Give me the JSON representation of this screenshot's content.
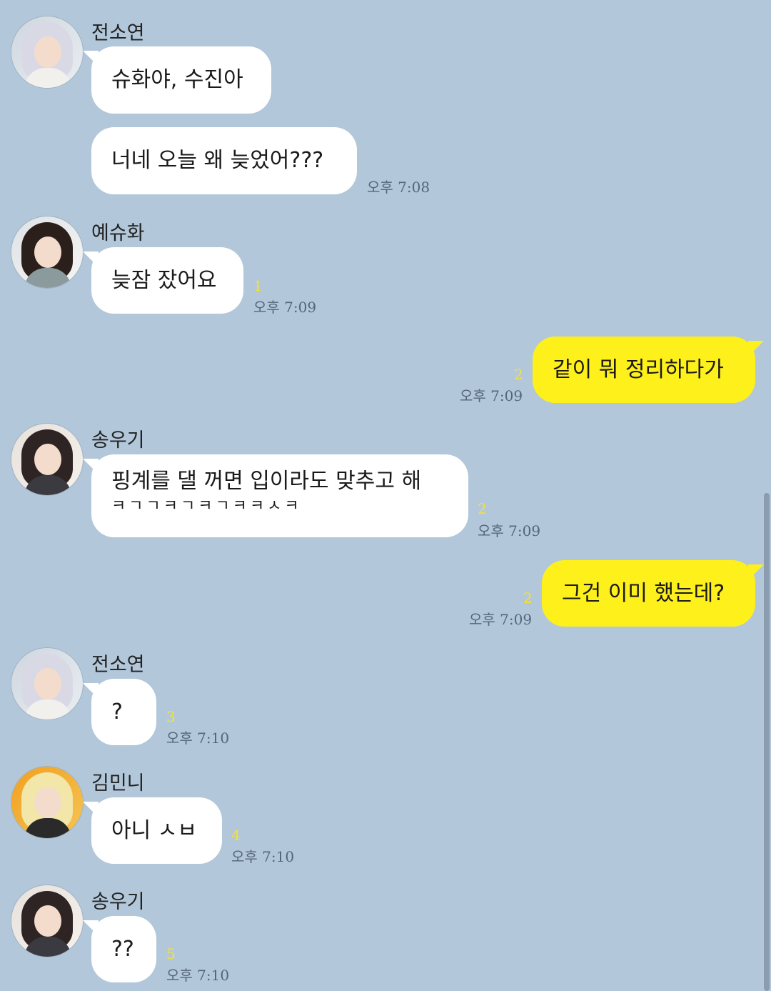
{
  "messages": [
    {
      "sender": "전소연",
      "text": "슈화야, 수진아"
    },
    {
      "text": "너네 오늘 왜 늦었어???",
      "time": "오후 7:08"
    },
    {
      "sender": "예슈화",
      "text": "늦잠 잤어요",
      "count": "1",
      "time": "오후 7:09"
    },
    {
      "mine": true,
      "text": "같이 뭐 정리하다가",
      "count": "2",
      "time": "오후 7:09"
    },
    {
      "sender": "송우기",
      "text_line1": "핑계를 댈 꺼면 입이라도 맞추고 해",
      "text_line2": "ㅋㄱㄱㅋㄱㅋㄱㅋㅋㅅㅋ",
      "count": "2",
      "time": "오후 7:09"
    },
    {
      "mine": true,
      "text": "그건 이미 했는데?",
      "count": "2",
      "time": "오후 7:09"
    },
    {
      "sender": "전소연",
      "text": "?",
      "count": "3",
      "time": "오후 7:10"
    },
    {
      "sender": "김민니",
      "text": "아니 ㅅㅂ",
      "count": "4",
      "time": "오후 7:10"
    },
    {
      "sender": "송우기",
      "text": "??",
      "count": "5",
      "time": "오후 7:10"
    }
  ],
  "colors": {
    "background": "#b2c7da",
    "incoming_bubble": "#ffffff",
    "outgoing_bubble": "#fef01b",
    "unread_count": "#f4e234"
  }
}
